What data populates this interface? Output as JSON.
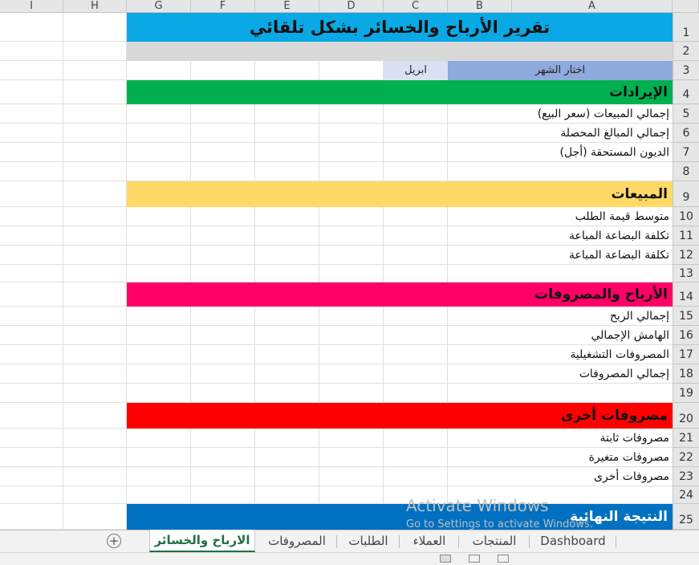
{
  "columns": [
    "I",
    "H",
    "G",
    "F",
    "E",
    "D",
    "C",
    "B",
    "A"
  ],
  "rows": [
    "1",
    "2",
    "3",
    "4",
    "5",
    "6",
    "7",
    "8",
    "9",
    "10",
    "11",
    "12",
    "13",
    "14",
    "15",
    "16",
    "17",
    "18",
    "19",
    "20",
    "21",
    "22",
    "23",
    "24",
    "25"
  ],
  "title": "تقرير الأرباح والخسائر بشكل تلقائي",
  "month_selector": {
    "label": "اختار الشهر",
    "value": "ابريل"
  },
  "sections": {
    "revenue": {
      "title": "الإيرادات",
      "items": [
        "إجمالي المبيعات (سعر البيع)",
        "إجمالي المبالغ المحصلة",
        "الديون المستحقة (أجل)"
      ]
    },
    "sales": {
      "title": "المبيعات",
      "items": [
        "متوسط قيمة الطلب",
        "تكلفة البضاعة المباعة",
        "تكلفة البضاعة المباعة"
      ]
    },
    "profits": {
      "title": "الأرباح والمصروفات",
      "items": [
        "إجمالي الربح",
        "الهامش الإجمالي",
        "المصروفات التشغيلية",
        "إجمالي المصروفات"
      ]
    },
    "other": {
      "title": "مصروفات أخرى",
      "items": [
        "مصروفات ثابتة",
        "مصروفات متغيرة",
        "مصروفات أخرى"
      ]
    },
    "final": {
      "title": "النتيجة النهائية"
    }
  },
  "colors": {
    "title": "#0aa9e6",
    "revenue": "#00b050",
    "sales": "#ffd966",
    "profits": "#ff0066",
    "other": "#ff0000",
    "final": "#0070c0",
    "selector_label": "#8faadc",
    "selector_value": "#d9e1f2"
  },
  "sheet_tabs": [
    "Dashboard",
    "المنتجات",
    "العملاء",
    "الطلبات",
    "المصروفات",
    "الارباح والخسائر"
  ],
  "active_tab": "الارباح والخسائر",
  "watermark": {
    "line1": "Activate Windows",
    "line2": "Go to Settings to activate Windows."
  }
}
